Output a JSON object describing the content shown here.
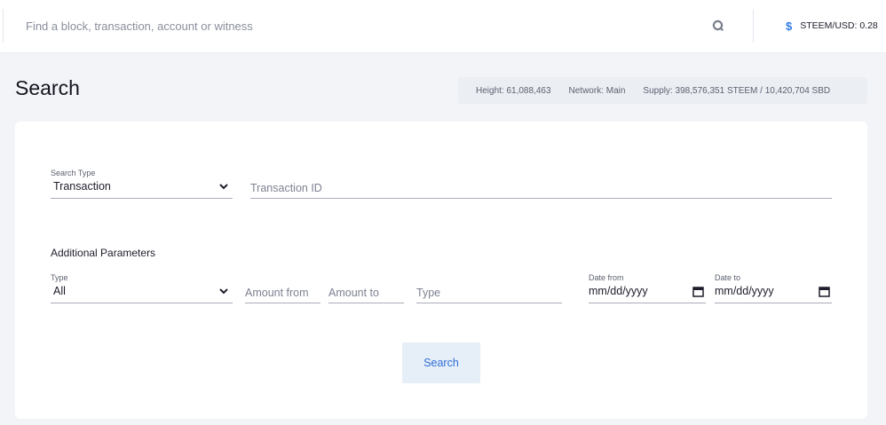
{
  "topbar": {
    "search_placeholder": "Find a block, transaction, account or witness",
    "search_icon": "search-icon",
    "price_icon": "dollar-icon",
    "price_text": "STEEM/USD: 0.28"
  },
  "header": {
    "title": "Search",
    "stats": {
      "height": "Height: 61,088,463",
      "network": "Network: Main",
      "supply": "Supply: 398,576,351 STEEM / 10,420,704 SBD"
    }
  },
  "form": {
    "search_type": {
      "label": "Search Type",
      "value": "Transaction"
    },
    "transaction_id": {
      "placeholder": "Transaction ID"
    },
    "additional_title": "Additional Parameters",
    "type_select": {
      "label": "Type",
      "value": "All"
    },
    "amount_from": {
      "placeholder": "Amount from"
    },
    "amount_to": {
      "placeholder": "Amount to"
    },
    "op_type": {
      "placeholder": "Type"
    },
    "date_from": {
      "label": "Date from",
      "value": "mm/dd/yyyy"
    },
    "date_to": {
      "label": "Date to",
      "value": "mm/dd/yyyy"
    },
    "submit_label": "Search"
  },
  "colors": {
    "accent": "#2f7be5",
    "background": "#f2f4f8",
    "button_bg": "#e6eef7"
  }
}
